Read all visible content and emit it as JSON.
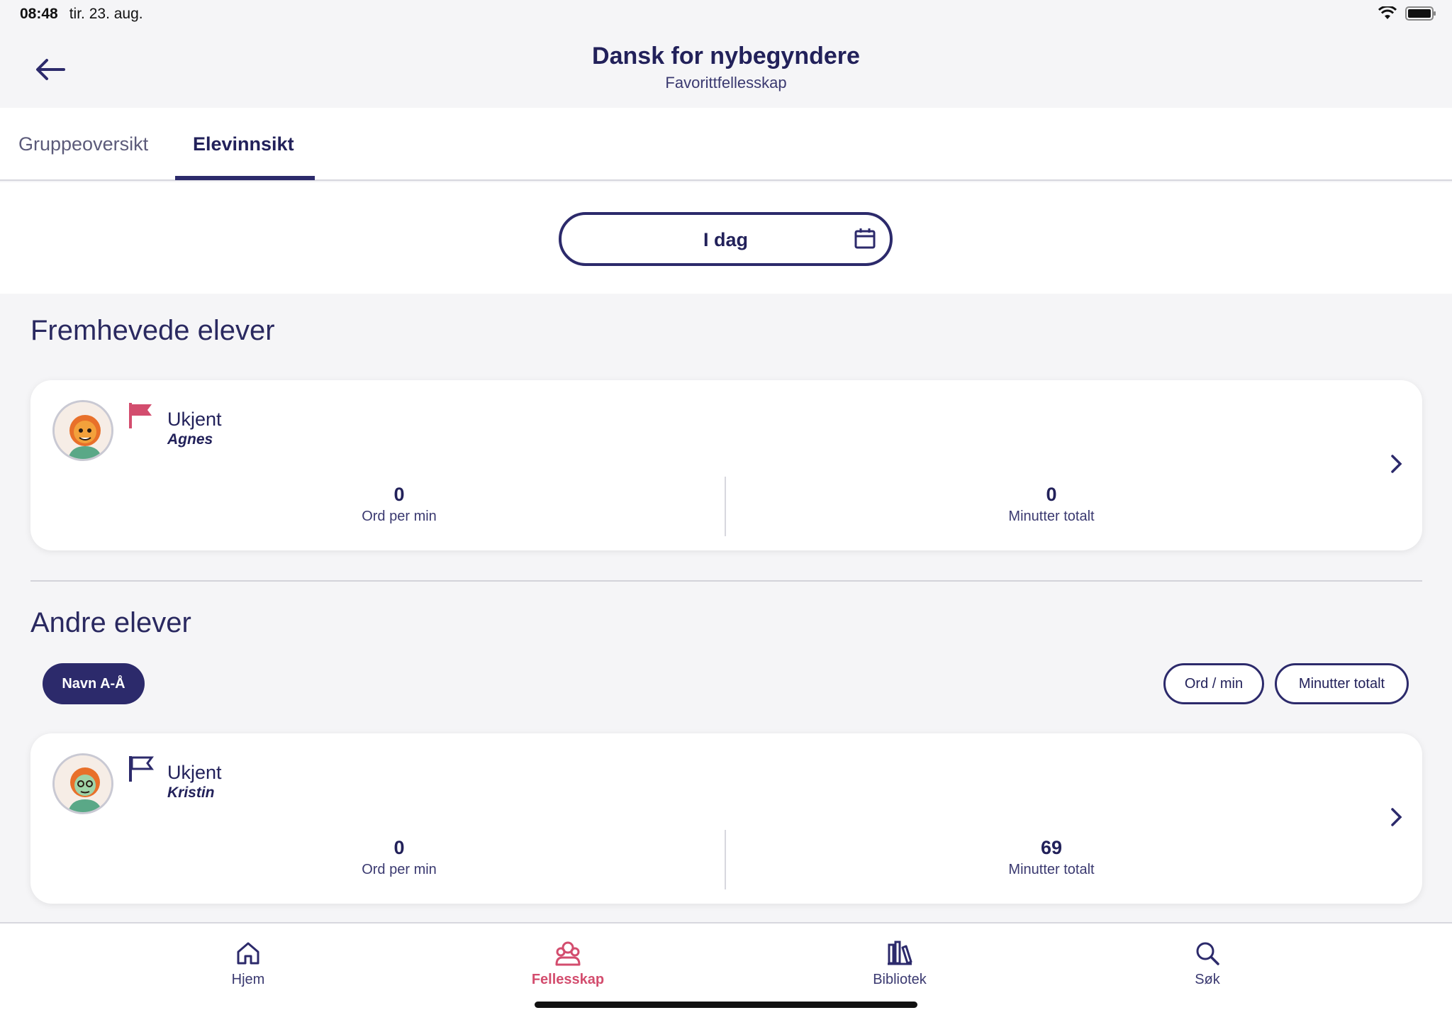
{
  "status_bar": {
    "time": "08:48",
    "date": "tir. 23. aug."
  },
  "header": {
    "title": "Dansk for nybegyndere",
    "subtitle": "Favorittfellesskap",
    "back_icon": "arrow-left-icon"
  },
  "tabs": [
    {
      "label": "Gruppeoversikt",
      "active": false
    },
    {
      "label": "Elevinnsikt",
      "active": true
    }
  ],
  "date_filter": {
    "label": "I dag",
    "icon": "calendar-icon"
  },
  "featured": {
    "title": "Fremhevede elever",
    "students": [
      {
        "status": "Ukjent",
        "name": "Agnes",
        "flagged": true,
        "words_per_min": "0",
        "words_per_min_label": "Ord per min",
        "minutes_total": "0",
        "minutes_total_label": "Minutter totalt"
      }
    ]
  },
  "others": {
    "title": "Andre elever",
    "sort_options": [
      "Navn A-Å",
      "Ord / min",
      "Minutter totalt"
    ],
    "active_sort": "Navn A-Å",
    "students": [
      {
        "status": "Ukjent",
        "name": "Kristin",
        "flagged": false,
        "words_per_min": "0",
        "words_per_min_label": "Ord per min",
        "minutes_total": "69",
        "minutes_total_label": "Minutter totalt"
      }
    ]
  },
  "bottom_nav": [
    {
      "label": "Hjem",
      "icon": "home-icon",
      "active": false
    },
    {
      "label": "Fellesskap",
      "icon": "community-icon",
      "active": true
    },
    {
      "label": "Bibliotek",
      "icon": "library-icon",
      "active": false
    },
    {
      "label": "Søk",
      "icon": "search-icon",
      "active": false
    }
  ],
  "colors": {
    "primary": "#2c2a6b",
    "accent": "#d34d6e",
    "background": "#f5f5f7"
  }
}
